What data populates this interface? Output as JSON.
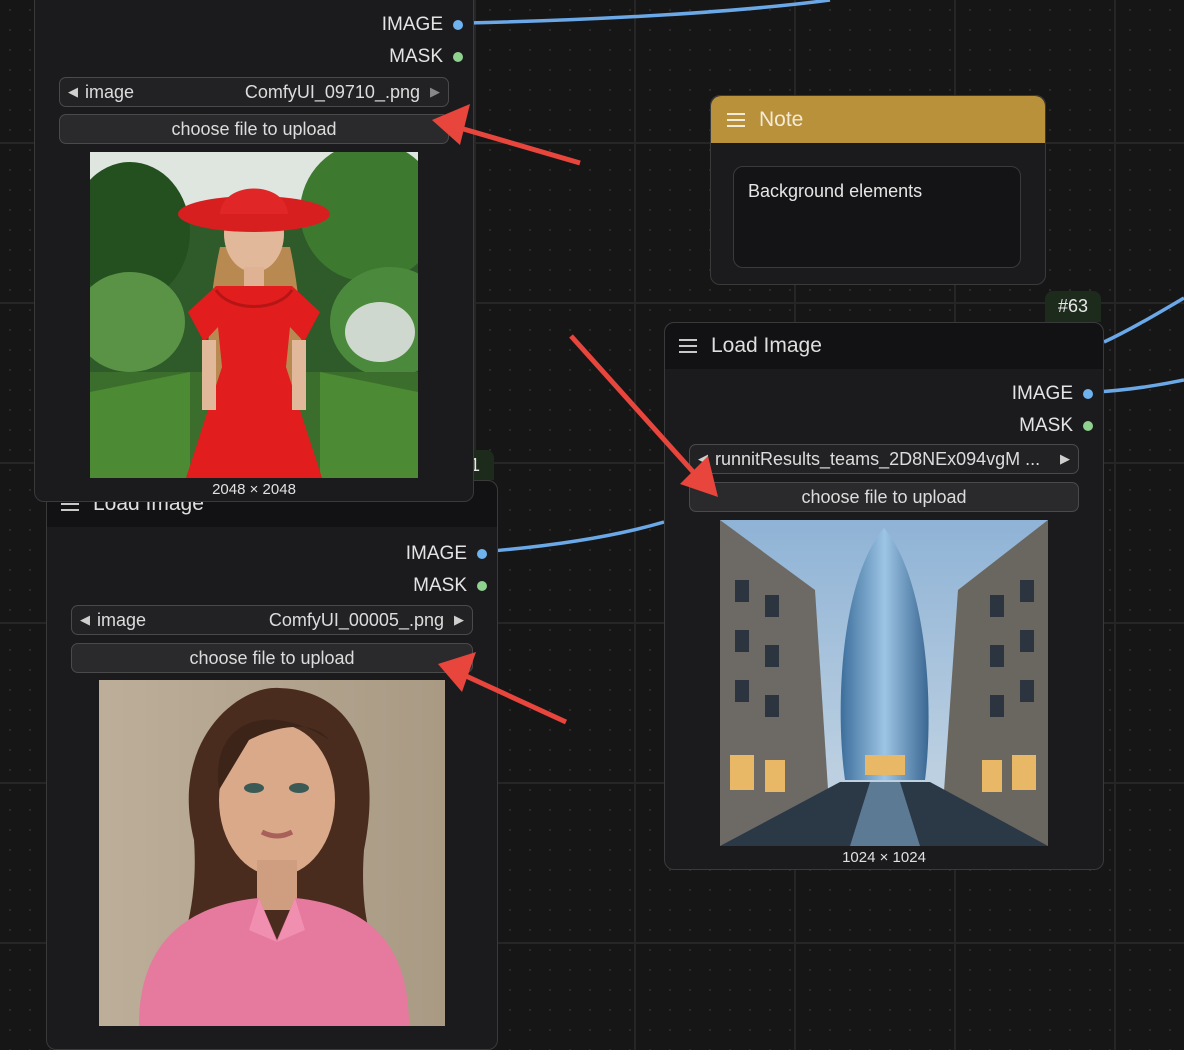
{
  "canvas": {
    "node_top": {
      "outputs": [
        "IMAGE",
        "MASK"
      ],
      "combo_label": "image",
      "combo_value": "ComfyUI_09710_.png",
      "upload_label": "choose file to upload",
      "dimensions": "2048 × 2048"
    },
    "node_left": {
      "badge": "1",
      "title": "Load Image",
      "outputs": [
        "IMAGE",
        "MASK"
      ],
      "combo_label": "image",
      "combo_value": "ComfyUI_00005_.png",
      "upload_label": "choose file to upload"
    },
    "node_right": {
      "badge": "#63",
      "title": "Load Image",
      "outputs": [
        "IMAGE",
        "MASK"
      ],
      "combo_value": "runnitResults_teams_2D8NEx094vgM ...",
      "upload_label": "choose file to upload",
      "dimensions": "1024 × 1024"
    },
    "note": {
      "title": "Note",
      "text": "Background elements"
    }
  },
  "colors": {
    "image_port": "#6fb3ee",
    "mask_port": "#8fd18f",
    "note_header": "#b9913a",
    "wire": "#6aa8e8",
    "annotation_arrow": "#e8453c"
  }
}
